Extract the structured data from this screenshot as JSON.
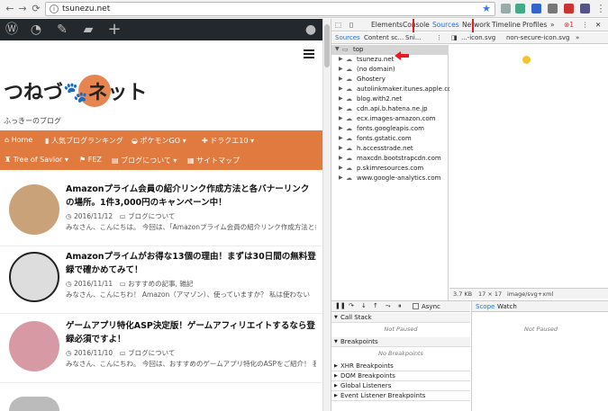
{
  "browser": {
    "url": "tsunezu.net"
  },
  "site": {
    "logo_text": "つねづ🐾ネット",
    "tagline": "ふっきーのブログ",
    "menu": [
      {
        "label": "Home",
        "icon": "home-icon"
      },
      {
        "label": "人気ブログランキング",
        "icon": "ranking-icon"
      },
      {
        "label": "ポケモンGO ▾",
        "icon": "pokeball-icon"
      },
      {
        "label": "ドラクエ10 ▾",
        "icon": "dq-icon"
      },
      {
        "label": "Tree of Savior ▾",
        "icon": "tos-icon"
      },
      {
        "label": "FEZ",
        "icon": "fez-icon"
      },
      {
        "label": "ブログについて ▾",
        "icon": "blog-icon"
      },
      {
        "label": "サイトマップ",
        "icon": "sitemap-icon"
      }
    ]
  },
  "posts": [
    {
      "title": "Amazonプライム会員の紹介リンク作成方法と各バナーリンクの場所。1件3,000円のキャンペーン中！",
      "date": "2016/11/12",
      "category": "ブログについて",
      "excerpt": "みなさん、こんにちは。 今回は、「Amazonプライム会員の紹介リンク作成方法と各バナーリンクの場所"
    },
    {
      "title": "Amazonプライムがお得な13個の理由！まずは30日間の無料登録で確かめてみて！",
      "date": "2016/11/11",
      "category": "おすすめの記事, 雑記",
      "excerpt": "みなさん、こんにちわ！ Amazon（アマゾン）、使っていますか？ 私は使わない"
    },
    {
      "title": "ゲームアプリ特化ASP決定版！ゲームアフィリエイトするなら登録必須ですよ！",
      "date": "2016/11/10",
      "category": "ブログについて",
      "excerpt": "みなさん、こんにちわ。 今回は、おすすめのゲームアプリ特化のASPをご紹介！ 我"
    }
  ],
  "devtools": {
    "tabs": [
      "Elements",
      "Console",
      "Sources",
      "Network",
      "Timeline",
      "Profiles",
      "»"
    ],
    "error_count": "1",
    "sub_tabs": [
      "Sources",
      "Content sc...",
      "Sni..."
    ],
    "file_tabs": [
      "...-icon.svg",
      "non-secure-icon.svg",
      "»"
    ],
    "tree": [
      "top",
      "tsunezu.net",
      "(no domain)",
      "Ghostery",
      "autolinkmaker.itunes.apple.com",
      "blog.with2.net",
      "cdn.api.b.hatena.ne.jp",
      "ecx.images-amazon.com",
      "fonts.googleapis.com",
      "fonts.gstatic.com",
      "h.accesstrade.net",
      "maxcdn.bootstrapcdn.com",
      "p.skimresources.com",
      "www.google-analytics.com"
    ],
    "status": {
      "size": "3.7 KB",
      "dims": "17 × 17",
      "mime": "image/svg+xml"
    },
    "async_label": "Async",
    "sections": [
      "Call Stack",
      "Breakpoints",
      "XHR Breakpoints",
      "DOM Breakpoints",
      "Global Listeners",
      "Event Listener Breakpoints"
    ],
    "not_paused": "Not Paused",
    "no_breakpoints": "No Breakpoints",
    "scope_tabs": [
      "Scope",
      "Watch"
    ],
    "scope_not_paused": "Not Paused"
  }
}
